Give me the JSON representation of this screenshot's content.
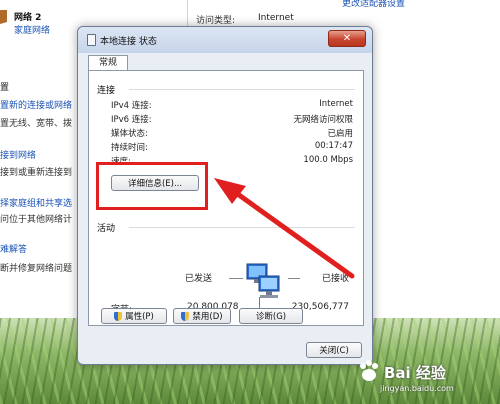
{
  "background": {
    "network_name": "网络 2",
    "network_type": "家庭网络",
    "access_type_label": "访问类型:",
    "access_type_value": "Internet",
    "top_link": "更改适配器设置",
    "section_label": "置",
    "side_links": [
      {
        "text": "置新的连接或网络",
        "style": "link"
      },
      {
        "text": "置无线、宽带、拨",
        "style": "plain"
      },
      {
        "text": "接到网络",
        "style": "link"
      },
      {
        "text": "接到或重新连接到",
        "style": "plain"
      },
      {
        "text": "择家庭组和共享选",
        "style": "link"
      },
      {
        "text": "问位于其他网络计",
        "style": "plain"
      },
      {
        "text": "难解答",
        "style": "link"
      },
      {
        "text": "断并修复网络问题",
        "style": "plain"
      }
    ]
  },
  "dialog": {
    "title": "本地连接 状态",
    "close_glyph": "✕",
    "tab": "常规",
    "connection_group": "连接",
    "rows": [
      {
        "label": "IPv4 连接:",
        "value": "Internet"
      },
      {
        "label": "IPv6 连接:",
        "value": "无网络访问权限"
      },
      {
        "label": "媒体状态:",
        "value": "已启用"
      },
      {
        "label": "持续时间:",
        "value": "00:17:47"
      },
      {
        "label": "速度:",
        "value": "100.0 Mbps"
      }
    ],
    "details_button": "详细信息(E)...",
    "activity_group": "活动",
    "sent_label": "已发送",
    "received_label": "已接收",
    "bytes_label": "字节:",
    "bytes_sent": "20,800,078",
    "bytes_received": "230,506,777",
    "properties_button": "属性(P)",
    "disable_button": "禁用(D)",
    "diagnose_button": "诊断(G)",
    "close_button": "关闭(C)"
  },
  "watermark": {
    "brand": "Bai 经验",
    "url": "jingyan.baidu.com"
  },
  "colors": {
    "annotation_red": "#e0201e",
    "link_blue": "#1a53b5"
  }
}
